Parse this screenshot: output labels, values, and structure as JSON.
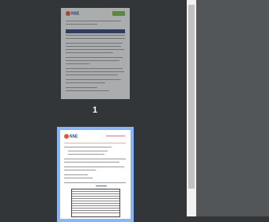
{
  "sidebar": {
    "thumbnails": [
      {
        "page_label": "1",
        "logo_text": "NSE",
        "selected": false
      },
      {
        "page_label": "",
        "logo_text": "NSE",
        "selected": true
      }
    ]
  },
  "colors": {
    "sidebar_bg": "#323639",
    "viewer_bg": "#525659",
    "selected_border": "#8ab4f8",
    "scrollbar_thumb": "#c1c1c1"
  }
}
